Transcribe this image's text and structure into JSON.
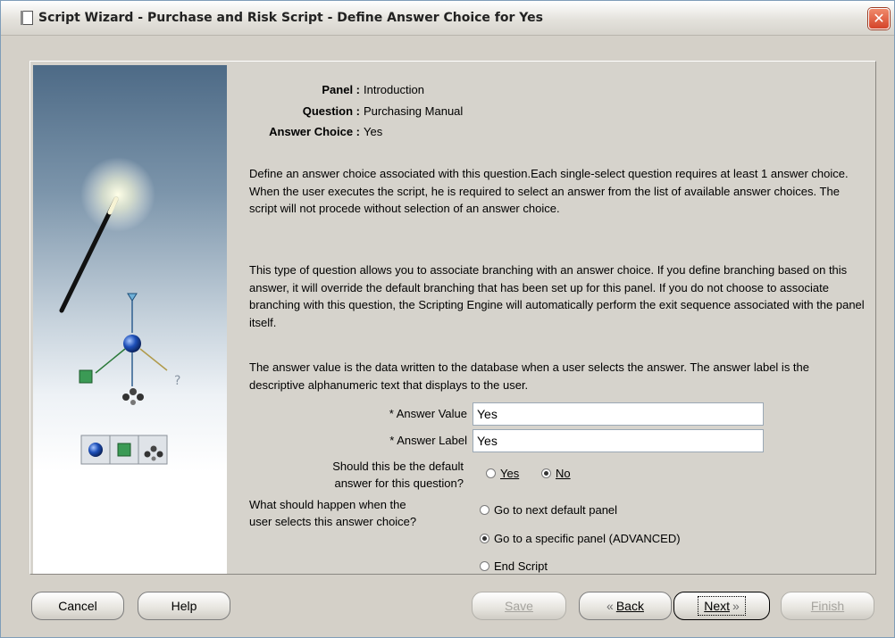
{
  "window": {
    "title": "Script Wizard - Purchase and Risk Script - Define Answer Choice for Yes",
    "close_glyph": "✕"
  },
  "info": {
    "panel_label": "Panel :",
    "panel_value": "Introduction",
    "question_label": "Question :",
    "question_value": "Purchasing Manual",
    "answer_choice_label": "Answer Choice :",
    "answer_choice_value": "Yes"
  },
  "paragraphs": [
    "Define an answer choice associated with this question.Each single-select question requires at least 1 answer choice. When the user executes the script, he is required to select an answer from the list of available answer choices. The script will not procede without selection of an answer choice.",
    "This type of question allows you to associate branching with an answer choice. If you define branching based on this answer, it will override the default branching that has been set up for this panel. If you do not choose to associate branching with this question, the Scripting Engine will automatically perform the exit sequence associated with the panel itself.",
    "The answer value is the data written to the database when a user selects the answer. The answer label is the descriptive alphanumeric text that displays to the user."
  ],
  "form": {
    "answer_value_label": "* Answer Value",
    "answer_value": "Yes",
    "answer_label_label": "* Answer Label",
    "answer_label_value": "Yes",
    "default_question_line1": "Should this be the default",
    "default_question_line2": "answer for this question?",
    "default_yes": "Yes",
    "default_no": "No",
    "default_selected": "No",
    "branch_question_line1": "What should happen when the",
    "branch_question_line2": "user selects this answer choice?",
    "branch_options": [
      "Go to next default panel",
      "Go to a specific panel (ADVANCED)",
      "End Script"
    ],
    "branch_selected": "Go to a specific panel (ADVANCED)"
  },
  "buttons": {
    "cancel": "Cancel",
    "help": "Help",
    "save": "Save",
    "back": "Back",
    "next": "Next",
    "finish": "Finish",
    "back_glyph": "«",
    "next_glyph": "»"
  },
  "icons": [
    "wizard-wand-icon",
    "sphere-icon",
    "cube-icon",
    "molecule-icon",
    "question-mark-icon"
  ]
}
